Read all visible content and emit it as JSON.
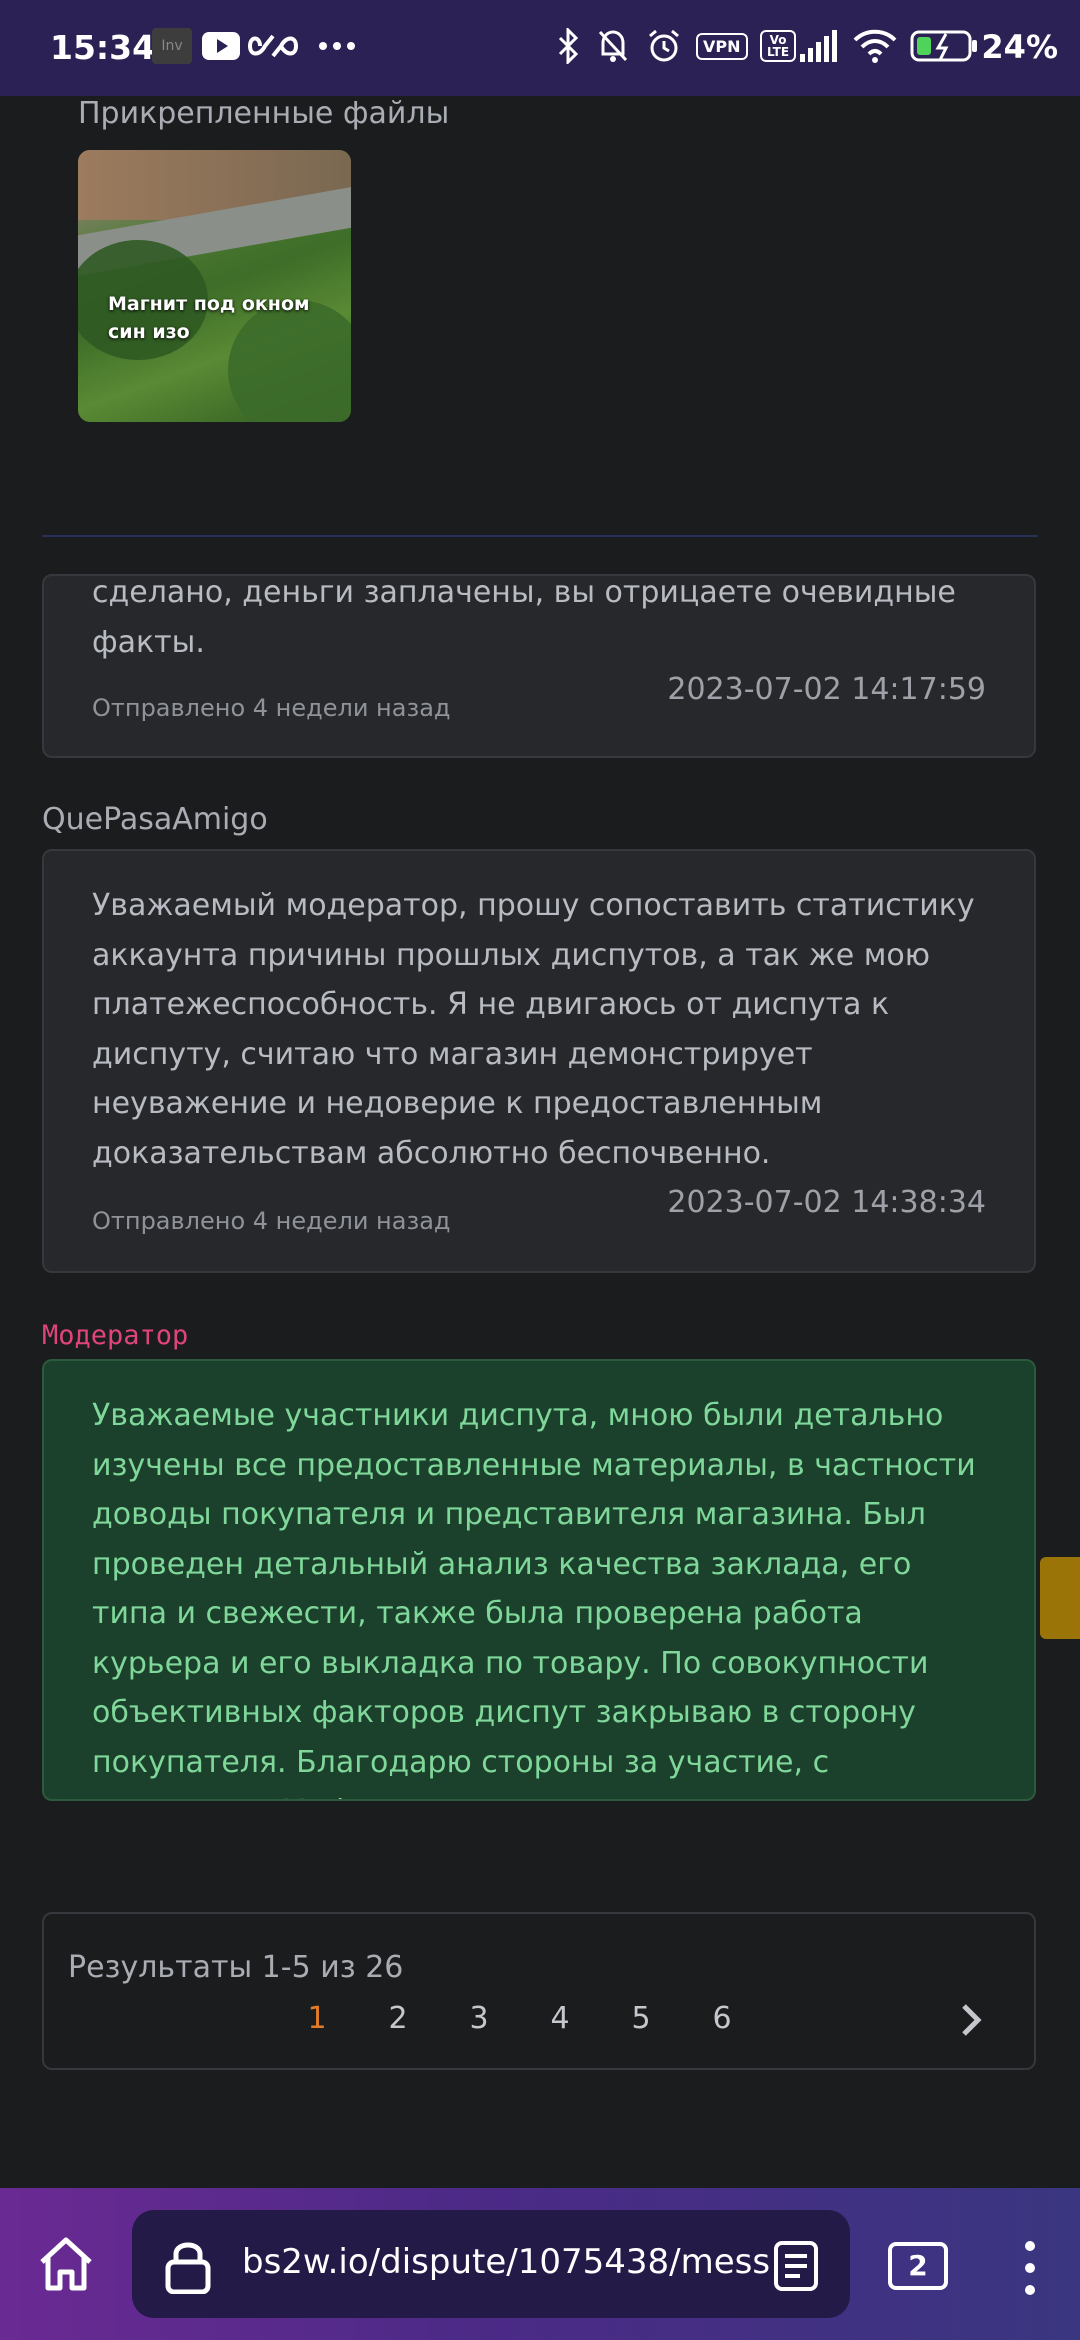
{
  "status_bar": {
    "time": "15:34",
    "vpn_label": "VPN",
    "volte_label": "Vo LTE",
    "battery_percent": "24%",
    "icons": [
      "inv-app-icon",
      "youtube-icon",
      "infinity-icon",
      "more-dots-icon",
      "bluetooth-icon",
      "bell-off-icon",
      "alarm-icon",
      "vpn-icon",
      "volte-icon",
      "signal-icon",
      "wifi-icon",
      "battery-icon"
    ]
  },
  "attachments": {
    "title": "Прикрепленные файлы",
    "items": [
      {
        "caption": "Магнит под окном син изо"
      }
    ]
  },
  "messages": [
    {
      "author": "",
      "body": "сделано, деньги заплачены, вы отрицаете очевидные факты.",
      "sent": "Отправлено 4 недели назад",
      "timestamp": "2023-07-02 14:17:59"
    },
    {
      "author": "QuePasaAmigo",
      "body": "Уважаемый модератор, прошу сопоставить статистику аккаунта причины прошлых диспутов, а так же мою платежеспособность. Я не двигаюсь от диспута к диспуту, считаю что магазин демонстрирует неуважение и недоверие к предоставленным доказательствам абсолютно беспочвенно.",
      "sent": "Отправлено 4 недели назад",
      "timestamp": "2023-07-02 14:38:34"
    },
    {
      "author": "Модератор",
      "body": "Уважаемые участники диспута, мною были детально изучены все предоставленные материалы, в частности доводы покупателя и представителя магазина. Был проведен детальный анализ качества заклада, его типа и свежести, также была проверена работа курьера и его выкладка по товару. По совокупности объективных факторов диспут закрываю в сторону покупателя. Благодарю стороны за участие, с уважением Moderator"
    }
  ],
  "pagination": {
    "results": "Результаты 1-5 из 26",
    "pages": [
      "1",
      "2",
      "3",
      "4",
      "5",
      "6"
    ],
    "active_page": "1"
  },
  "browser": {
    "url": "bs2w.io/dispute/1075438/mess",
    "tab_count": "2"
  },
  "colors": {
    "status_bar_bg": "#2b2154",
    "page_bg": "#1b1c1e",
    "card_bg": "#26282b",
    "moderator_card_bg": "#1b402b",
    "moderator_text": "#7fd79a",
    "moderator_author": "#e0447a",
    "active_page": "#e07b2a",
    "side_tab": "#9a7406"
  }
}
